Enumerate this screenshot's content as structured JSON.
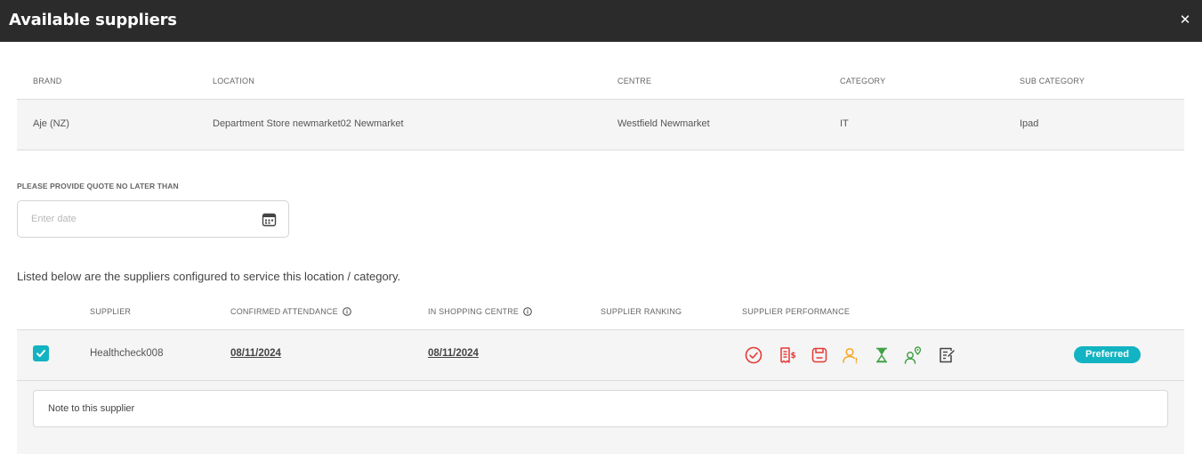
{
  "modal": {
    "title": "Available suppliers",
    "close_icon": "close-icon"
  },
  "info": {
    "headers": [
      "BRAND",
      "LOCATION",
      "CENTRE",
      "CATEGORY",
      "SUB CATEGORY"
    ],
    "row": [
      "Aje (NZ)",
      "Department Store newmarket02 Newmarket",
      "Westfield Newmarket",
      "IT",
      "Ipad"
    ]
  },
  "quote": {
    "label": "PLEASE PROVIDE QUOTE NO LATER THAN",
    "placeholder": "Enter date",
    "value": ""
  },
  "listed_text": "Listed below are the suppliers configured to service this location / category.",
  "suppliers": {
    "headers": [
      "SUPPLIER",
      "CONFIRMED ATTENDANCE",
      "IN SHOPPING CENTRE",
      "SUPPLIER RANKING",
      "SUPPLIER PERFORMANCE"
    ],
    "rows": [
      {
        "checked": true,
        "name": "Healthcheck008",
        "confirmed_attendance": "08/11/2024",
        "in_shopping_centre": "08/11/2024",
        "ranking": "",
        "badge": "Preferred",
        "performance_icons": [
          {
            "name": "check-circle-icon",
            "color": "#e53935"
          },
          {
            "name": "invoice-dollar-icon",
            "color": "#e53935"
          },
          {
            "name": "save-icon",
            "color": "#e53935"
          },
          {
            "name": "user-alert-icon",
            "color": "#f5a623"
          },
          {
            "name": "hourglass-icon",
            "color": "#43a047"
          },
          {
            "name": "user-location-icon",
            "color": "#43a047"
          },
          {
            "name": "checklist-icon",
            "color": "#444444"
          }
        ]
      }
    ],
    "note_placeholder": "Note to this supplier"
  },
  "colors": {
    "accent": "#12b3c2",
    "header_bg": "#2b2b2b",
    "row_bg": "#f5f5f5"
  }
}
